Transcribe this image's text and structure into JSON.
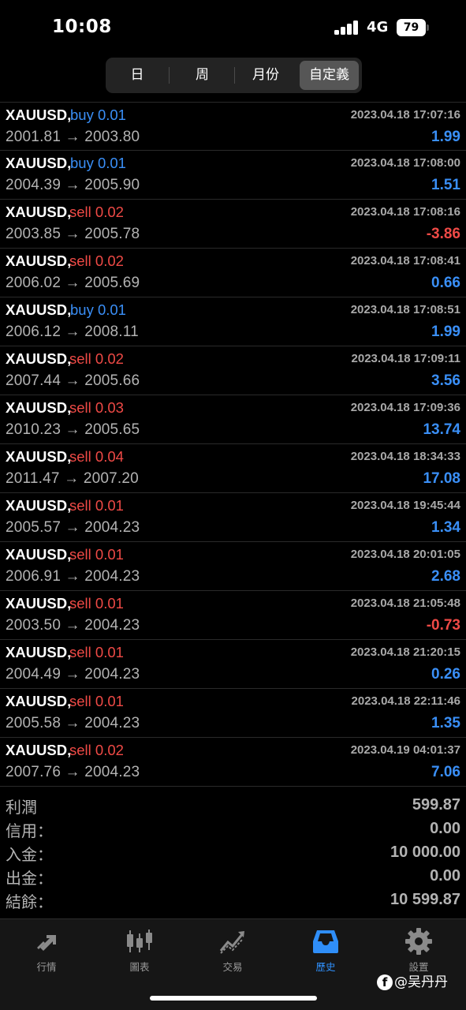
{
  "status_bar": {
    "time": "10:08",
    "network": "4G",
    "battery": "79"
  },
  "period_tabs": [
    {
      "label": "日",
      "active": false
    },
    {
      "label": "周",
      "active": false
    },
    {
      "label": "月份",
      "active": false
    },
    {
      "label": "自定義",
      "active": true
    }
  ],
  "trades": [
    {
      "symbol": "XAUUSD,",
      "side": "buy",
      "lots": "buy 0.01",
      "datetime": "2023.04.18 17:07:16",
      "prices": "2001.81 → 2003.80",
      "profit": "1.99"
    },
    {
      "symbol": "XAUUSD,",
      "side": "buy",
      "lots": "buy 0.01",
      "datetime": "2023.04.18 17:08:00",
      "prices": "2004.39 → 2005.90",
      "profit": "1.51"
    },
    {
      "symbol": "XAUUSD,",
      "side": "sell",
      "lots": "sell 0.02",
      "datetime": "2023.04.18 17:08:16",
      "prices": "2003.85 → 2005.78",
      "profit": "-3.86"
    },
    {
      "symbol": "XAUUSD,",
      "side": "sell",
      "lots": "sell 0.02",
      "datetime": "2023.04.18 17:08:41",
      "prices": "2006.02 → 2005.69",
      "profit": "0.66"
    },
    {
      "symbol": "XAUUSD,",
      "side": "buy",
      "lots": "buy 0.01",
      "datetime": "2023.04.18 17:08:51",
      "prices": "2006.12 → 2008.11",
      "profit": "1.99"
    },
    {
      "symbol": "XAUUSD,",
      "side": "sell",
      "lots": "sell 0.02",
      "datetime": "2023.04.18 17:09:11",
      "prices": "2007.44 → 2005.66",
      "profit": "3.56"
    },
    {
      "symbol": "XAUUSD,",
      "side": "sell",
      "lots": "sell 0.03",
      "datetime": "2023.04.18 17:09:36",
      "prices": "2010.23 → 2005.65",
      "profit": "13.74"
    },
    {
      "symbol": "XAUUSD,",
      "side": "sell",
      "lots": "sell 0.04",
      "datetime": "2023.04.18 18:34:33",
      "prices": "2011.47 → 2007.20",
      "profit": "17.08"
    },
    {
      "symbol": "XAUUSD,",
      "side": "sell",
      "lots": "sell 0.01",
      "datetime": "2023.04.18 19:45:44",
      "prices": "2005.57 → 2004.23",
      "profit": "1.34"
    },
    {
      "symbol": "XAUUSD,",
      "side": "sell",
      "lots": "sell 0.01",
      "datetime": "2023.04.18 20:01:05",
      "prices": "2006.91 → 2004.23",
      "profit": "2.68"
    },
    {
      "symbol": "XAUUSD,",
      "side": "sell",
      "lots": "sell 0.01",
      "datetime": "2023.04.18 21:05:48",
      "prices": "2003.50 → 2004.23",
      "profit": "-0.73"
    },
    {
      "symbol": "XAUUSD,",
      "side": "sell",
      "lots": "sell 0.01",
      "datetime": "2023.04.18 21:20:15",
      "prices": "2004.49 → 2004.23",
      "profit": "0.26"
    },
    {
      "symbol": "XAUUSD,",
      "side": "sell",
      "lots": "sell 0.01",
      "datetime": "2023.04.18 22:11:46",
      "prices": "2005.58 → 2004.23",
      "profit": "1.35"
    },
    {
      "symbol": "XAUUSD,",
      "side": "sell",
      "lots": "sell 0.02",
      "datetime": "2023.04.19 04:01:37",
      "prices": "2007.76 → 2004.23",
      "profit": "7.06"
    }
  ],
  "summary": [
    {
      "label": "利潤",
      "value": "599.87"
    },
    {
      "label": "信用：",
      "value": "0.00"
    },
    {
      "label": "入金：",
      "value": "10 000.00"
    },
    {
      "label": "出金：",
      "value": "0.00"
    },
    {
      "label": "結餘：",
      "value": "10 599.87"
    }
  ],
  "tab_bar": [
    {
      "label": "行情",
      "icon": "quotes-arrows-icon",
      "active": false
    },
    {
      "label": "圖表",
      "icon": "candlestick-chart-icon",
      "active": false
    },
    {
      "label": "交易",
      "icon": "trade-chart-icon",
      "active": false
    },
    {
      "label": "歷史",
      "icon": "history-inbox-icon",
      "active": true
    },
    {
      "label": "設置",
      "icon": "gear-icon",
      "active": false
    }
  ],
  "watermark": {
    "text": "@吴丹丹",
    "icon": "facebook-icon"
  },
  "colors": {
    "buy": "#3a8ff7",
    "sell": "#ef4a46",
    "active_tab": "#2f8ef8",
    "background": "#000000"
  }
}
